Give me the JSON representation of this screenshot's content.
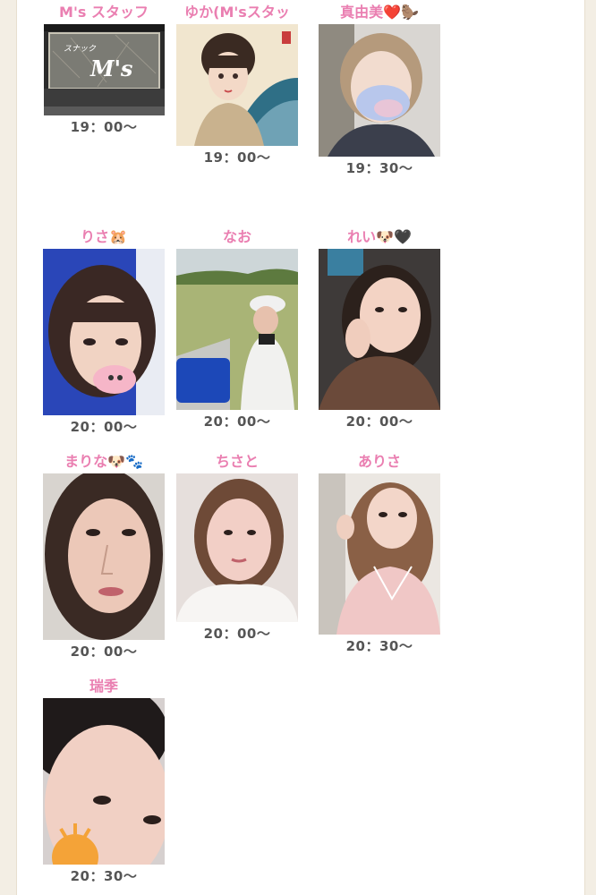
{
  "staff": [
    {
      "name": "M's スタッフ",
      "time": "19：00〜",
      "photo_icon": "store-sign-photo"
    },
    {
      "name": "ゆか(M'sスタッ",
      "time": "19：00〜",
      "photo_icon": "illustration-portrait-photo"
    },
    {
      "name": "真由美❤️🦫",
      "time": "19：30〜",
      "photo_icon": "portrait-photo"
    },
    {
      "name": "りさ🐹",
      "time": "20：00〜",
      "photo_icon": "portrait-photo"
    },
    {
      "name": "なお",
      "time": "20：00〜",
      "photo_icon": "golf-course-photo"
    },
    {
      "name": "れい🐶🖤",
      "time": "20：00〜",
      "photo_icon": "portrait-photo"
    },
    {
      "name": "まりな🐶🐾",
      "time": "20：00〜",
      "photo_icon": "portrait-photo"
    },
    {
      "name": "ちさと",
      "time": "20：00〜",
      "photo_icon": "portrait-photo"
    },
    {
      "name": "ありさ",
      "time": "20：30〜",
      "photo_icon": "portrait-photo"
    },
    {
      "name": "瑞季",
      "time": "20：30〜",
      "photo_icon": "portrait-photo"
    }
  ],
  "sign_text": {
    "top": "スナック",
    "main": "M's"
  },
  "colors": {
    "name_pink": "#ea7fb1",
    "time_gray": "#555555",
    "page_bg": "#ffffff",
    "outer_bg": "#f3eee4"
  }
}
